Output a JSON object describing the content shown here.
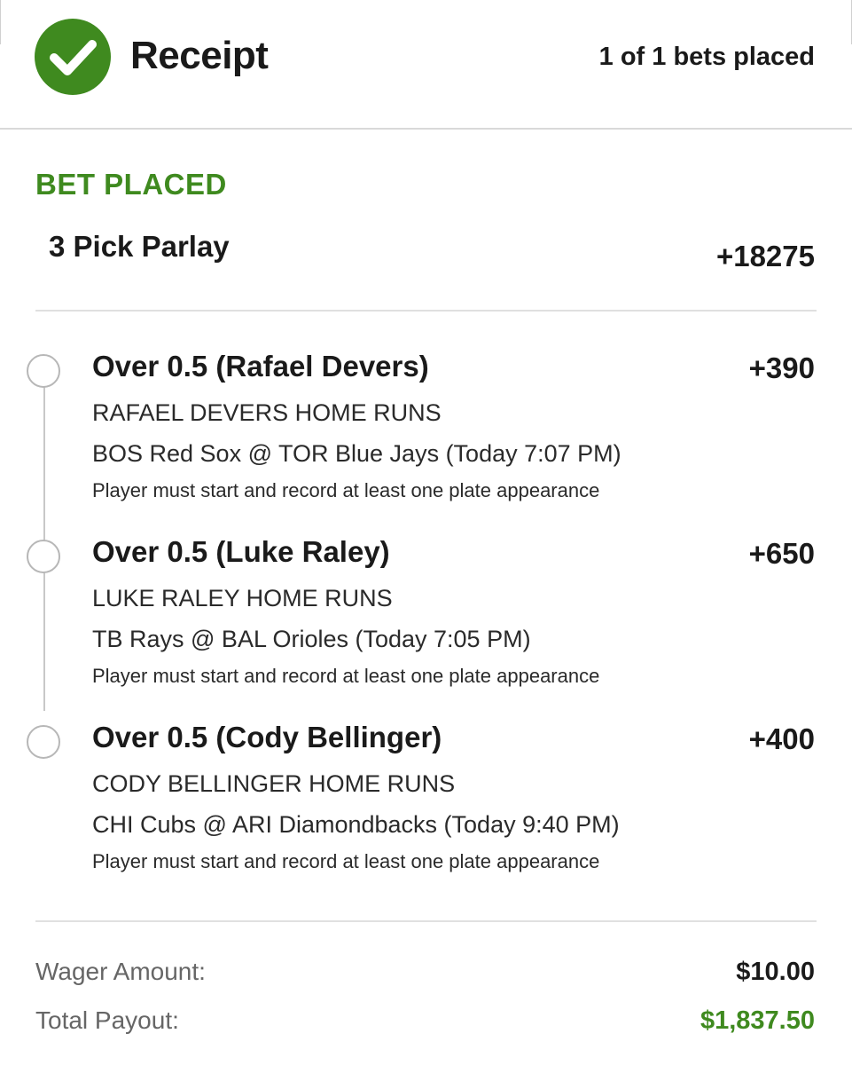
{
  "header": {
    "title": "Receipt",
    "bets_placed": "1 of 1 bets placed",
    "icon": "check-circle-icon"
  },
  "bet": {
    "status": "BET PLACED",
    "type": "3 Pick Parlay",
    "odds": "+18275"
  },
  "legs": [
    {
      "selection": "Over 0.5 (Rafael Devers)",
      "odds": "+390",
      "market": "RAFAEL DEVERS HOME RUNS",
      "event": "BOS Red Sox @ TOR Blue Jays (Today 7:07 PM)",
      "rule": "Player must start and record at least one plate appearance"
    },
    {
      "selection": "Over 0.5 (Luke Raley)",
      "odds": "+650",
      "market": "LUKE RALEY HOME RUNS",
      "event": "TB Rays @ BAL Orioles (Today 7:05 PM)",
      "rule": "Player must start and record at least one plate appearance"
    },
    {
      "selection": "Over 0.5 (Cody Bellinger)",
      "odds": "+400",
      "market": "CODY BELLINGER HOME RUNS",
      "event": "CHI Cubs @ ARI Diamondbacks (Today 9:40 PM)",
      "rule": "Player must start and record at least one plate appearance"
    }
  ],
  "summary": {
    "wager_label": "Wager Amount:",
    "wager_value": "$10.00",
    "payout_label": "Total Payout:",
    "payout_value": "$1,837.50"
  },
  "colors": {
    "accent_green": "#3f8a1f",
    "text": "#1a1a1a",
    "muted": "#666666"
  }
}
